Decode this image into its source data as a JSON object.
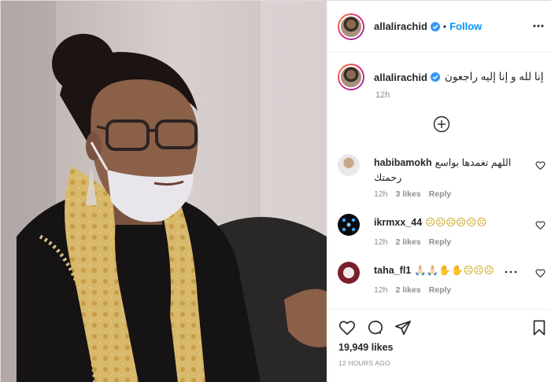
{
  "post": {
    "username": "allalirachid",
    "follow_label": "Follow",
    "separator": "•",
    "caption": "إنا لله و إنا إليه راجعون",
    "caption_time": "12h",
    "likes": "19,949 likes",
    "posted_ago": "12 HOURS AGO"
  },
  "comments": [
    {
      "user": "habibamokh",
      "text": "اللهم تغمدها بواسع",
      "text2": "رحمتك",
      "time": "12h",
      "likes": "3 likes",
      "reply": "Reply"
    },
    {
      "user": "ikrmxx_44",
      "text": "☹☹☹☹☹☹",
      "time": "12h",
      "likes": "2 likes",
      "reply": "Reply"
    },
    {
      "user": "taha_fl1",
      "text": "🙏🏻🙏🏻✋✋☹☹☹",
      "time": "12h",
      "likes": "2 likes",
      "reply": "Reply"
    }
  ],
  "icons": {
    "verified": "verified-badge-icon",
    "more": "more-options-icon",
    "load_more": "plus-circle-icon",
    "like": "heart-icon",
    "comment": "comment-icon",
    "share": "paper-plane-icon",
    "save": "bookmark-icon"
  },
  "colors": {
    "accent": "#0095f6",
    "muted": "#8e8e8e",
    "text": "#262626"
  }
}
